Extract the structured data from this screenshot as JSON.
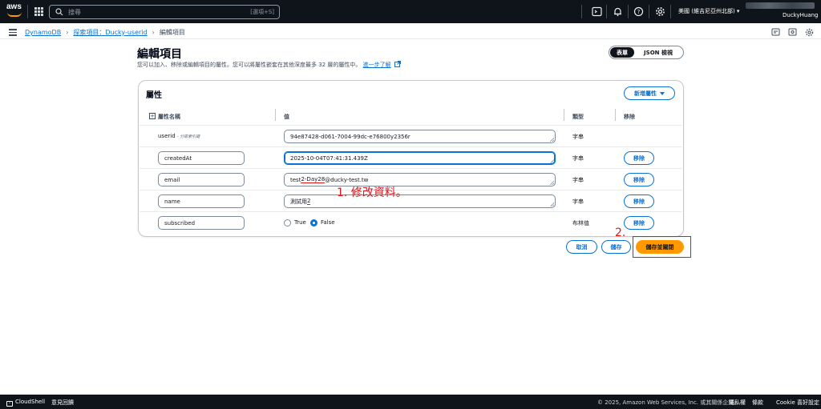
{
  "topbar": {
    "logo_text": "aws",
    "search_placeholder": "搜尋",
    "search_shortcut": "[選項+S]",
    "region": "美國 (維吉尼亞州北部)",
    "user": "DuckyHuang"
  },
  "breadcrumb": {
    "items": [
      "DynamoDB",
      "探索項目：Ducky-userid"
    ],
    "current": "編輯項目"
  },
  "header": {
    "title": "編輯項目",
    "description": "您可以加入、移除或編輯項目的屬性。您可以將屬性嵌套在其他深度最多 32 層的屬性中。",
    "learn_more": "進一步了解",
    "view_toggle": {
      "form": "表單",
      "json": "JSON 檢視"
    }
  },
  "attributes": {
    "title": "屬性",
    "add_button": "新增屬性",
    "columns": {
      "name": "屬性名稱",
      "value": "值",
      "type": "類型",
      "remove": "移除"
    },
    "rows": [
      {
        "name": "userid",
        "note": "- 分區索引鍵",
        "value": "94e87428-d061-7004-99dc-e76800y2356r",
        "type": "字串"
      },
      {
        "name": "createdAt",
        "value": "2025-10-04T07:41:31.439Z",
        "type": "字串",
        "remove": "移除"
      },
      {
        "name": "email",
        "value_a": "test",
        "value_b": "2-Day28",
        "value_c": "@ducky-test.tw",
        "type": "字串",
        "remove": "移除"
      },
      {
        "name": "name",
        "value_a": "測試用",
        "value_b": "2",
        "type": "字串",
        "remove": "移除"
      },
      {
        "name": "subscribed",
        "true_label": "True",
        "false_label": "False",
        "selected": "False",
        "type": "布林值",
        "remove": "移除"
      }
    ]
  },
  "annotations": {
    "step1": "1. 修改資料。",
    "step2": "2."
  },
  "actions": {
    "cancel": "取消",
    "save": "儲存",
    "save_close": "儲存並關閉"
  },
  "footer": {
    "cloudshell": "CloudShell",
    "feedback": "意見回饋",
    "copyright": "© 2025, Amazon Web Services, Inc. 或其關係企業。",
    "privacy": "隱私權",
    "terms": "條款",
    "cookie": "Cookie 喜好設定"
  }
}
